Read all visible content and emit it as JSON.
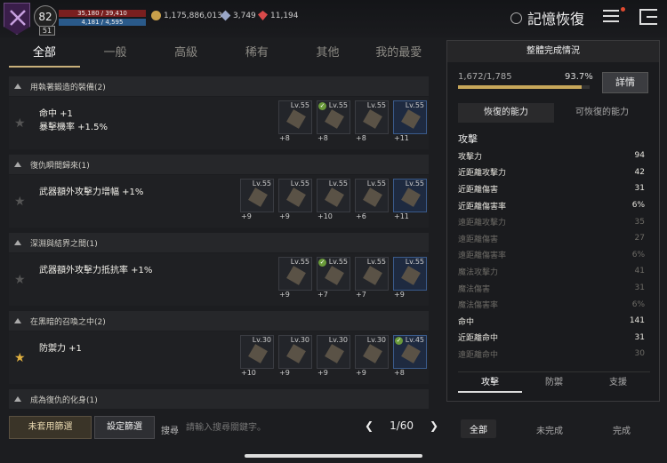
{
  "header": {
    "level": "82",
    "sub_level": "51",
    "hp": "35,180 / 39,410",
    "mp": "4,181 / 4,595",
    "gold": "1,175,886,013",
    "gems": "3,749",
    "rubies": "11,194",
    "title": "記憶恢復"
  },
  "tabs": [
    "全部",
    "一般",
    "高級",
    "稀有",
    "其他",
    "我的最愛"
  ],
  "groups": [
    {
      "name": "用執著鍛造的裝備(2)",
      "stats": [
        "命中 +1",
        "暴擊機率 +1.5%"
      ],
      "starred": false,
      "items": [
        {
          "lv": "Lv.55",
          "plus": "+8",
          "check": false
        },
        {
          "lv": "Lv.55",
          "plus": "+8",
          "check": true
        },
        {
          "lv": "Lv.55",
          "plus": "+8",
          "check": false
        },
        {
          "lv": "Lv.55",
          "plus": "+11",
          "check": false
        }
      ]
    },
    {
      "name": "復仇瞬間歸來(1)",
      "stats": [
        "武器額外攻擊力增幅 +1%"
      ],
      "starred": false,
      "items": [
        {
          "lv": "Lv.55",
          "plus": "+9",
          "check": false
        },
        {
          "lv": "Lv.55",
          "plus": "+9",
          "check": false
        },
        {
          "lv": "Lv.55",
          "plus": "+10",
          "check": false
        },
        {
          "lv": "Lv.55",
          "plus": "+6",
          "check": false
        },
        {
          "lv": "Lv.55",
          "plus": "+11",
          "check": false
        }
      ]
    },
    {
      "name": "深淵與結界之間(1)",
      "stats": [
        "武器額外攻擊力抵抗率 +1%"
      ],
      "starred": false,
      "items": [
        {
          "lv": "Lv.55",
          "plus": "+9",
          "check": false
        },
        {
          "lv": "Lv.55",
          "plus": "+7",
          "check": true
        },
        {
          "lv": "Lv.55",
          "plus": "+7",
          "check": false
        },
        {
          "lv": "Lv.55",
          "plus": "+9",
          "check": false
        }
      ]
    },
    {
      "name": "在黑暗的召喚之中(2)",
      "stats": [
        "防禦力 +1"
      ],
      "starred": true,
      "items": [
        {
          "lv": "Lv.30",
          "plus": "+10",
          "check": false
        },
        {
          "lv": "Lv.30",
          "plus": "+9",
          "check": false
        },
        {
          "lv": "Lv.30",
          "plus": "+9",
          "check": false
        },
        {
          "lv": "Lv.30",
          "plus": "+9",
          "check": false
        },
        {
          "lv": "Lv.45",
          "plus": "+8",
          "check": true
        }
      ]
    },
    {
      "name": "成為復仇的化身(1)",
      "stats": [],
      "starred": false,
      "items": []
    }
  ],
  "panel": {
    "title": "整體完成情況",
    "progress": "1,672/1,785",
    "percent": "93.7%",
    "detail_button": "詳情",
    "subtab_restored": "恢復的能力",
    "subtab_restorable": "可恢復的能力",
    "category": "攻擊",
    "rows": [
      {
        "label": "攻擊力",
        "value": "94",
        "dim": false
      },
      {
        "label": "近距離攻擊力",
        "value": "42",
        "dim": false
      },
      {
        "label": "近距離傷害",
        "value": "31",
        "dim": false
      },
      {
        "label": "近距離傷害率",
        "value": "6%",
        "dim": false
      },
      {
        "label": "遠距離攻擊力",
        "value": "35",
        "dim": true
      },
      {
        "label": "遠距離傷害",
        "value": "27",
        "dim": true
      },
      {
        "label": "遠距離傷害率",
        "value": "6%",
        "dim": true
      },
      {
        "label": "魔法攻擊力",
        "value": "41",
        "dim": true
      },
      {
        "label": "魔法傷害",
        "value": "31",
        "dim": true
      },
      {
        "label": "魔法傷害率",
        "value": "6%",
        "dim": true
      },
      {
        "label": "命中",
        "value": "141",
        "dim": false
      },
      {
        "label": "近距離命中",
        "value": "31",
        "dim": false
      },
      {
        "label": "遠距離命中",
        "value": "30",
        "dim": true
      }
    ],
    "bottom_tabs": [
      "攻擊",
      "防禦",
      "支援"
    ]
  },
  "bottom": {
    "unused_filter": "未套用篩選",
    "set_filter": "設定篩選",
    "search_label": "搜尋",
    "search_placeholder": "請輸入搜尋關鍵字。",
    "page": "1/60",
    "filter_all": "全部",
    "filter_incomplete": "未完成",
    "filter_complete": "完成"
  }
}
